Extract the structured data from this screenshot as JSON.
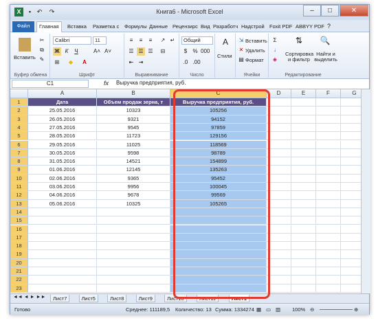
{
  "window": {
    "title": "Книга6 - Microsoft Excel"
  },
  "tabs": [
    "Файл",
    "Главная",
    "Вставка",
    "Разметка с",
    "Формулы",
    "Данные",
    "Рецензирс",
    "Вид",
    "Разработч",
    "Надстрой",
    "Foxit PDF",
    "ABBYY PDF"
  ],
  "ribbon": {
    "paste": "Вставить",
    "font_name": "Calibri",
    "font_size": "11",
    "number_format": "Общий",
    "styles": "Стили",
    "insert": "Вставить",
    "delete": "Удалить",
    "format": "Формат",
    "sort": "Сортировка и фильтр",
    "find": "Найти и выделить",
    "groups": [
      "Буфер обмена",
      "Шрифт",
      "Выравнивание",
      "Число",
      "Ячейки",
      "Редактирование"
    ]
  },
  "formula_bar": {
    "name_box": "C1",
    "fx": "fx",
    "content": "Выручка предприятия, руб."
  },
  "columns": [
    "A",
    "B",
    "C",
    "D",
    "E",
    "F",
    "G"
  ],
  "rows": [
    "1",
    "2",
    "3",
    "4",
    "5",
    "6",
    "7",
    "8",
    "9",
    "10",
    "11",
    "12",
    "13",
    "14",
    "15",
    "16",
    "17",
    "18",
    "19",
    "20",
    "21",
    "22",
    "23"
  ],
  "table": {
    "headers": [
      "Дата",
      "Объем продаж зерна, т",
      "Выручка предприятия, руб."
    ],
    "data": [
      [
        "25.05.2016",
        "10323",
        "105256"
      ],
      [
        "26.05.2016",
        "9321",
        "94152"
      ],
      [
        "27.05.2016",
        "9545",
        "97859"
      ],
      [
        "28.05.2016",
        "11723",
        "129156"
      ],
      [
        "29.05.2016",
        "11025",
        "118569"
      ],
      [
        "30.05.2016",
        "9598",
        "98789"
      ],
      [
        "31.05.2016",
        "14521",
        "154899"
      ],
      [
        "01.06.2016",
        "12145",
        "135263"
      ],
      [
        "02.06.2016",
        "9365",
        "95452"
      ],
      [
        "03.06.2016",
        "9956",
        "100045"
      ],
      [
        "04.06.2016",
        "9678",
        "99569"
      ],
      [
        "05.06.2016",
        "10325",
        "105265"
      ]
    ]
  },
  "sheet_tabs": [
    "Лист7",
    "Лист5",
    "Лист8",
    "Лист9",
    "Лист10",
    "Лист11",
    "Лист1"
  ],
  "status": {
    "ready": "Готово",
    "average": "Среднее: 111189,5",
    "count": "Количество: 13",
    "sum": "Сумма: 1334274",
    "zoom": "100%"
  },
  "colors": {
    "header_bg": "#5a4f86",
    "selection": "#a7c8ef",
    "highlight_frame": "#e03b2e"
  }
}
